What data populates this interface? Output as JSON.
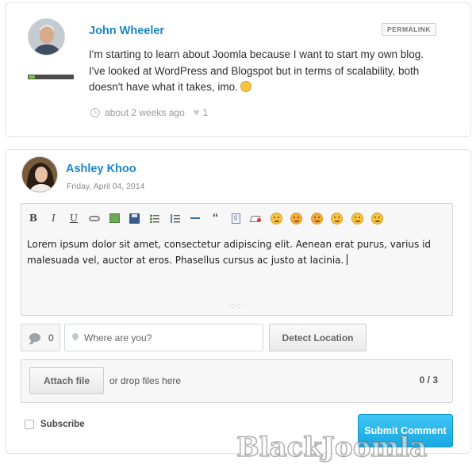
{
  "comment": {
    "author": "John Wheeler",
    "permalink_label": "PERMALINK",
    "text": "I'm starting to learn about Joomla because I want to start my own blog. I've looked at WordPress and Blogspot but in terms of scalability, both doesn't have what it takes, imo.",
    "time": "about 2 weeks ago",
    "likes": "1",
    "rank_progress": 0.15
  },
  "form": {
    "author": "Ashley Khoo",
    "date": "Friday, April 04, 2014",
    "toolbar": {
      "bold": "B",
      "italic": "I",
      "underline": "U",
      "quote": "“"
    },
    "editor_text": "Lorem ipsum dolor sit amet, consectetur adipiscing elit. Aenean erat purus, varius id malesuada vel, auctor at eros. Phasellus cursus ac justo at lacinia.",
    "resize_grip": "·:·:·",
    "comment_count": "0",
    "location_placeholder": "Where are you?",
    "detect_location_label": "Detect Location",
    "attach_label": "Attach file",
    "drop_text": "or drop files here",
    "file_count": "0 / 3",
    "subscribe_label": "Subscribe",
    "submit_label": "Submit Comment"
  },
  "watermark": "BlackJoomla",
  "colors": {
    "accent": "#1a86c8",
    "submit": "#1fb2e8"
  }
}
